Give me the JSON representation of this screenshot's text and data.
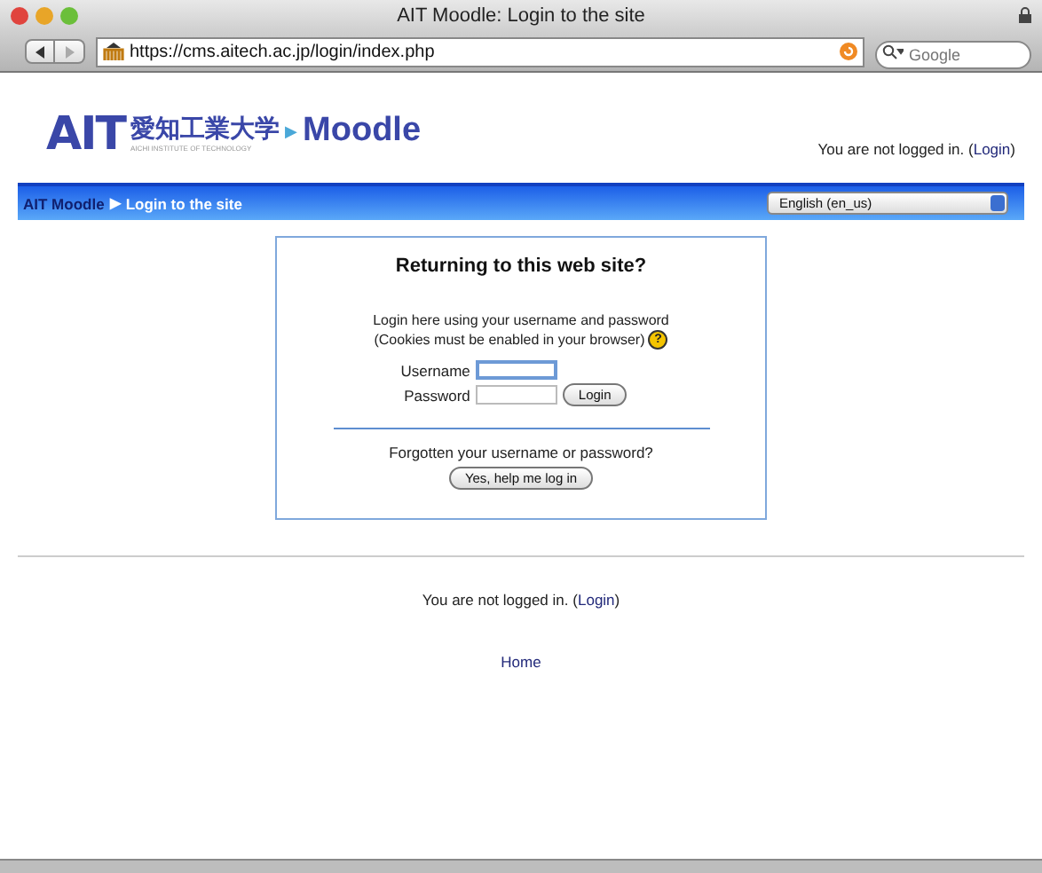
{
  "window": {
    "title": "AIT Moodle: Login to the site"
  },
  "toolbar": {
    "url": "https://cms.aitech.ac.jp/login/index.php",
    "search_placeholder": "Google"
  },
  "header": {
    "logo_mark": "AIT",
    "logo_japanese": "愛知工業大学",
    "logo_subtitle": "AICHI INSTITUTE OF TECHNOLOGY",
    "logo_arrow": "▶",
    "logo_product": "Moodle",
    "login_status": "You are not logged in.",
    "open_paren": "(",
    "login_link": "Login",
    "close_paren": ")"
  },
  "navbar": {
    "breadcrumbs": [
      {
        "label": "AIT Moodle",
        "kind": "link"
      },
      {
        "label": "Login to the site",
        "kind": "current"
      }
    ],
    "separator": "▶",
    "language": "English (en_us)"
  },
  "login_box": {
    "heading": "Returning to this web site?",
    "intro_line_1": "Login here using your username and password",
    "intro_line_2": "(Cookies must be enabled in your browser)",
    "help_glyph": "?",
    "username_label": "Username",
    "password_label": "Password",
    "login_button": "Login",
    "forgot_text": "Forgotten your username or password?",
    "help_button": "Yes, help me log in"
  },
  "footer": {
    "login_status": "You are not logged in.",
    "open_paren": "(",
    "login_link": "Login",
    "close_paren": ")",
    "home_link": "Home"
  }
}
